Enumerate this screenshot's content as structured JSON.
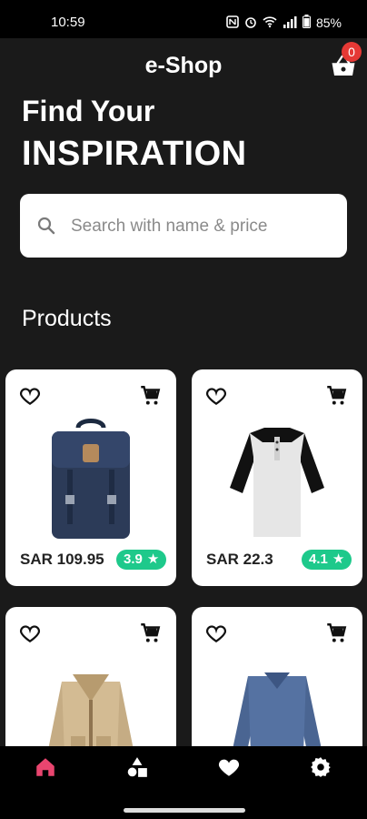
{
  "status": {
    "time": "10:59",
    "battery": "85%"
  },
  "header": {
    "title": "e-Shop",
    "cart_count": "0"
  },
  "hero": {
    "line1": "Find Your",
    "line2": "INSPIRATION"
  },
  "search": {
    "placeholder": "Search with name & price"
  },
  "products_section": {
    "title": "Products"
  },
  "products": [
    {
      "name": "backpack",
      "price": "SAR 109.95",
      "rating": "3.9"
    },
    {
      "name": "raglan-shirt",
      "price": "SAR 22.3",
      "rating": "4.1"
    },
    {
      "name": "jacket",
      "price": "",
      "rating": ""
    },
    {
      "name": "long-sleeve-tee",
      "price": "",
      "rating": ""
    }
  ],
  "nav": {
    "active": "home"
  },
  "colors": {
    "accent": "#e53935",
    "rating": "#1ec98b",
    "nav_active": "#e9456f"
  }
}
